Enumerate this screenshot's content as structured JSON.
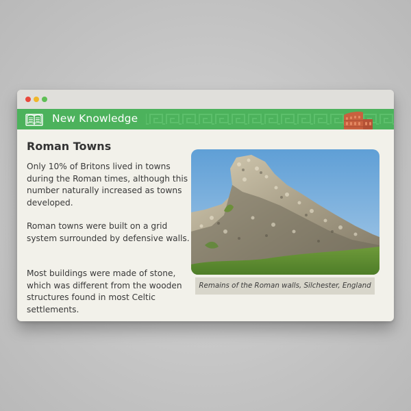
{
  "window": {
    "controls": [
      "close",
      "minimize",
      "maximize"
    ]
  },
  "banner": {
    "title": "New Knowledge",
    "icon_left": "open-book-icon",
    "icon_right": "colosseum-icon",
    "accent_color": "#4cb25c"
  },
  "content": {
    "heading": "Roman Towns",
    "paragraphs": [
      "Only 10% of Britons lived in towns during the Roman times, although this number naturally increased as towns developed.",
      "Roman towns were built on a grid system surrounded by defensive walls.",
      "Most buildings were made of stone, which was different from the wooden structures found in most Celtic settlements."
    ]
  },
  "figure": {
    "caption": "Remains of the Roman walls, Silchester, England"
  }
}
